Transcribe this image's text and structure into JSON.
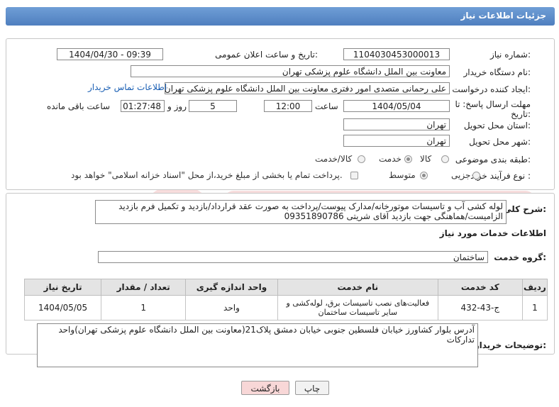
{
  "header": {
    "title": "جزئیات اطلاعات نیاز"
  },
  "form": {
    "need_number_label": "شماره نیاز:",
    "need_number": "1104030453000013",
    "announce_label": "تاریخ و ساعت اعلان عمومی:",
    "announce_value": "1404/04/30 - 09:39",
    "buyer_org_label": "نام دستگاه خریدار:",
    "buyer_org": "معاونت بین الملل دانشگاه علوم پزشکی تهران",
    "creator_label": "ایجاد کننده درخواست:",
    "creator": "علی رحمانی متصدی امور دفتری معاونت بین الملل دانشگاه علوم پزشکی تهران",
    "contact_link": "اطلاعات تماس خریدار",
    "deadline_label_1": "مهلت ارسال پاسخ: تا",
    "deadline_label_2": "تاریخ:",
    "deadline_date": "1404/05/04",
    "time_label": "ساعت",
    "deadline_time": "12:00",
    "days_value": "5",
    "days_label": "روز و",
    "remaining_time": "01:27:48",
    "remaining_label": "ساعت باقی مانده",
    "province_label": "استان محل تحویل:",
    "province": "تهران",
    "city_label": "شهر محل تحویل:",
    "city": "تهران",
    "category_label": "طبقه بندی موضوعی:",
    "category_options": [
      "کالا",
      "خدمت",
      "کالا/خدمت"
    ],
    "category_selected": "خدمت",
    "process_label": "نوع فرآیند خرید :",
    "process_options": [
      "جزیی",
      "متوسط"
    ],
    "process_selected": "متوسط",
    "payment_note": "پرداخت تمام یا بخشی از مبلغ خرید،از محل \"اسناد خزانه اسلامی\" خواهد بود."
  },
  "description": {
    "label": "شرح کلی نیاز:",
    "text": "لوله کشی آب و تاسیسات موتورخانه/مدارک پیوست/پرداخت به صورت عقد قرارداد/بازدید و تکمیل فرم بازدید الزامیست/هماهنگی جهت بازدید  آقای شریتی 09351890786"
  },
  "services": {
    "section_title": "اطلاعات خدمات مورد نیاز",
    "group_label": "گروه خدمت:",
    "group_value": "ساختمان",
    "columns": [
      "ردیف",
      "کد خدمت",
      "نام خدمت",
      "واحد اندازه گیری",
      "تعداد / مقدار",
      "تاریخ نیاز"
    ],
    "rows": [
      [
        "1",
        "ج-43-432",
        "فعالیت‌های نصب تاسیسات برق، لوله‌کشی و سایر تاسیسات ساختمان",
        "واحد",
        "1",
        "1404/05/05"
      ]
    ]
  },
  "buyer_notes": {
    "label": "توضیحات خریدار:",
    "text": "آدرس بلوار کشاورز خیابان فلسطین جنوبی خیابان دمشق پلاک21(معاونت بین الملل دانشگاه علوم پزشکی تهران)واحد تدارکات"
  },
  "buttons": {
    "print": "چاپ",
    "back": "بازگشت"
  },
  "colors": {
    "header": "#5b8cca",
    "link": "#1a5fb4",
    "back_button": "#f8d7d7"
  }
}
